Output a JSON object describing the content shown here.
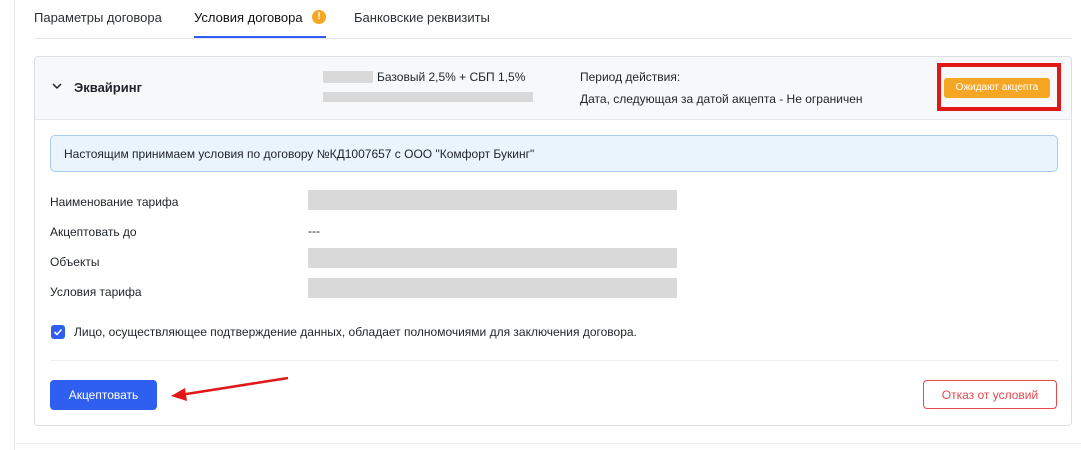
{
  "tabs": [
    {
      "label": "Параметры договора"
    },
    {
      "label": "Условия договора"
    },
    {
      "label": "Банковские реквизиты"
    }
  ],
  "active_tab_warning": "!",
  "acquiring": {
    "title": "Эквайринг",
    "tariff_summary": "Базовый 2,5% + СБП 1,5%",
    "period_title": "Период действия:",
    "period_value": "Дата, следующая за датой акцепта - Не ограничен",
    "status": "Ожидают акцепта"
  },
  "info_text": "Настоящим принимаем условия по договору №КД1007657 с ООО \"Комфорт Букинг\"",
  "fields": {
    "tariff_name_label": "Наименование тарифа",
    "accept_until_label": "Акцептовать до",
    "accept_until_value": "---",
    "objects_label": "Объекты",
    "tariff_terms_label": "Условия тарифа"
  },
  "authority_checkbox": {
    "checked": true,
    "label": "Лицо, осуществляющее подтверждение данных, обладает полномочиями для заключения договора."
  },
  "buttons": {
    "accept": "Акцептовать",
    "refuse": "Отказ от условий"
  },
  "colors": {
    "primary": "#2f5ff0",
    "status_pending": "#f5a623",
    "danger": "#e5484d",
    "annotation_red": "#e01818",
    "info_bg": "#eaf4fd"
  }
}
